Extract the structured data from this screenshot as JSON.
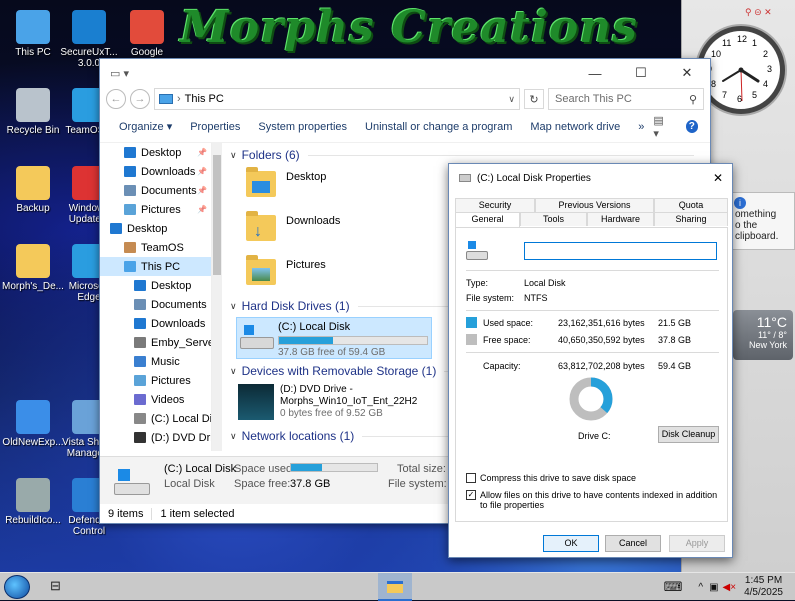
{
  "desktop": {
    "banner": "Morphs Creations",
    "icons": [
      {
        "label": "This PC",
        "icon": "computer-icon",
        "color": "#4aa3e8"
      },
      {
        "label": "SecureUxT... 3.0.0",
        "icon": "brush-icon",
        "color": "#1a7fd0"
      },
      {
        "label": "Google",
        "icon": "chrome-icon",
        "color": "#e24b3b"
      },
      {
        "label": "Recycle Bin",
        "icon": "recycle-bin-icon",
        "color": "#b9c3cc"
      },
      {
        "label": "TeamOS...",
        "icon": "edge-icon",
        "color": "#2a9de0"
      },
      {
        "label": "Backup",
        "icon": "folder-icon",
        "color": "#f4c95a"
      },
      {
        "label": "Windows Update...",
        "icon": "update-icon",
        "color": "#d33"
      },
      {
        "label": "Morph's_De...",
        "icon": "folder-icon",
        "color": "#f4c95a"
      },
      {
        "label": "Microsoft Edge",
        "icon": "edge-icon",
        "color": "#2a9de0"
      },
      {
        "label": "OldNewExp...",
        "icon": "shield-icon",
        "color": "#3b8ee8"
      },
      {
        "label": "Vista Shor... Manage...",
        "icon": "app-icon",
        "color": "#6aa2d8"
      },
      {
        "label": "RebuildIco...",
        "icon": "robot-icon",
        "color": "#9aa"
      },
      {
        "label": "Defender Control",
        "icon": "shield-icon",
        "color": "#2a7fd4"
      }
    ]
  },
  "gadgets": {
    "clock_numerals": [
      "12",
      "1",
      "2",
      "3",
      "4",
      "5",
      "6",
      "7",
      "8",
      "9",
      "10",
      "11"
    ],
    "note_text": "omething\no the\nclipboard.",
    "weather": {
      "temp": "11°C",
      "range": "11° / 8°",
      "city": "New York"
    }
  },
  "explorer": {
    "breadcrumb": "This PC",
    "search_placeholder": "Search This PC",
    "commands": [
      "Organize",
      "Properties",
      "System properties",
      "Uninstall or change a program",
      "Map network drive",
      "»"
    ],
    "nav": [
      {
        "label": "Desktop",
        "pinned": true,
        "color": "#1f78d1"
      },
      {
        "label": "Downloads",
        "pinned": true,
        "color": "#1f78d1"
      },
      {
        "label": "Documents",
        "pinned": true,
        "color": "#6b8fb5"
      },
      {
        "label": "Pictures",
        "pinned": true,
        "color": "#5aa3d8"
      },
      {
        "label": "Desktop",
        "pinned": false,
        "color": "#1f78d1"
      },
      {
        "label": "TeamOS",
        "pinned": false,
        "color": "#c58b52"
      },
      {
        "label": "This PC",
        "pinned": false,
        "color": "#4aa3e8"
      },
      {
        "label": "Desktop",
        "pinned": false,
        "color": "#1f78d1"
      },
      {
        "label": "Documents",
        "pinned": false,
        "color": "#6b8fb5"
      },
      {
        "label": "Downloads",
        "pinned": false,
        "color": "#1f78d1"
      },
      {
        "label": "Emby_Server",
        "pinned": false,
        "color": "#7a7a7a"
      },
      {
        "label": "Music",
        "pinned": false,
        "color": "#3a7fd0"
      },
      {
        "label": "Pictures",
        "pinned": false,
        "color": "#5aa3d8"
      },
      {
        "label": "Videos",
        "pinned": false,
        "color": "#6b6bd0"
      },
      {
        "label": "(C:) Local Disk",
        "pinned": false,
        "color": "#888"
      },
      {
        "label": "(D:) DVD Drive -",
        "pinned": false,
        "color": "#333"
      },
      {
        "label": "Libraries",
        "pinned": false,
        "color": "#e0b040"
      }
    ],
    "groups": {
      "folders": "Folders (6)",
      "drives": "Hard Disk Drives (1)",
      "removable": "Devices with Removable Storage (1)",
      "network": "Network locations (1)"
    },
    "folders": [
      "Desktop",
      "Downloads",
      "Pictures"
    ],
    "c_drive": {
      "name": "(C:) Local Disk",
      "free_text": "37.8 GB free of 59.4 GB",
      "used_fraction": 0.362
    },
    "d_drive": {
      "name": "(D:) DVD Drive -",
      "label": "Morphs_Win10_IoT_Ent_22H2",
      "free_text": "0 bytes free of 9.52 GB"
    },
    "details": {
      "name": "(C:) Local Disk",
      "type": "Local Disk",
      "space_used_label": "Space used:",
      "space_free_label": "Space free:",
      "space_free": "37.8 GB",
      "total_size_label": "Total size:",
      "file_system_label": "File system:",
      "used_fraction": 0.362
    },
    "status": {
      "items": "9 items",
      "selected": "1 item selected"
    }
  },
  "props": {
    "title": "(C:) Local Disk Properties",
    "tabs_top": [
      "Security",
      "Previous Versions",
      "Quota"
    ],
    "tabs_bottom": [
      "General",
      "Tools",
      "Hardware",
      "Sharing"
    ],
    "name_value": "",
    "type_label": "Type:",
    "type_value": "Local Disk",
    "fs_label": "File system:",
    "fs_value": "NTFS",
    "used_label": "Used space:",
    "used_bytes": "23,162,351,616 bytes",
    "used_gb": "21.5 GB",
    "free_label": "Free space:",
    "free_bytes": "40,650,350,592 bytes",
    "free_gb": "37.8 GB",
    "cap_label": "Capacity:",
    "cap_bytes": "63,812,702,208 bytes",
    "cap_gb": "59.4 GB",
    "drive_label": "Drive C:",
    "cleanup": "Disk Cleanup",
    "compress": "Compress this drive to save disk space",
    "index": "Allow files on this drive to have contents indexed in addition to file properties",
    "used_fraction": 0.363,
    "colors": {
      "used": "#26a0da",
      "free": "#bebebe"
    },
    "ok": "OK",
    "cancel": "Cancel",
    "apply": "Apply"
  },
  "taskbar": {
    "time": "1:45 PM",
    "date": "4/5/2025"
  }
}
